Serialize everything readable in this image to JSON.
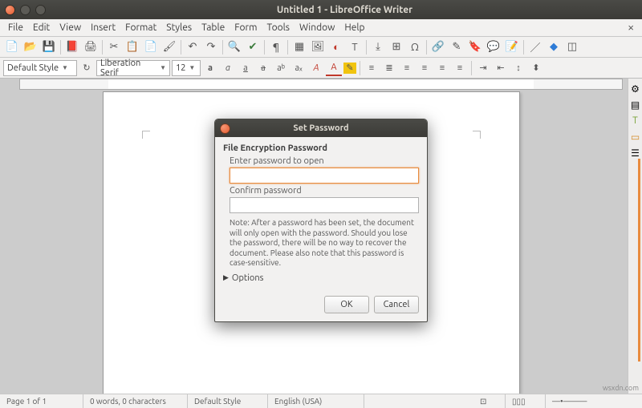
{
  "window": {
    "title": "Untitled 1 - LibreOffice Writer"
  },
  "menu": {
    "items": [
      "File",
      "Edit",
      "View",
      "Insert",
      "Format",
      "Styles",
      "Table",
      "Form",
      "Tools",
      "Window",
      "Help"
    ]
  },
  "format": {
    "para_style": "Default Style",
    "font_name": "Liberation Serif",
    "font_size": "12"
  },
  "dialog": {
    "title": "Set Password",
    "section": "File Encryption Password",
    "enter_label": "Enter password to open",
    "confirm_label": "Confirm password",
    "note": "Note: After a password has been set, the document will only open with the password. Should you lose the password, there will be no way to recover the document. Please also note that this password is case-sensitive.",
    "options_label": "Options",
    "ok": "OK",
    "cancel": "Cancel"
  },
  "status": {
    "page": "Page 1 of 1",
    "words": "0 words, 0 characters",
    "style": "Default Style",
    "lang": "English (USA)"
  },
  "watermark": "wsxdn.com"
}
